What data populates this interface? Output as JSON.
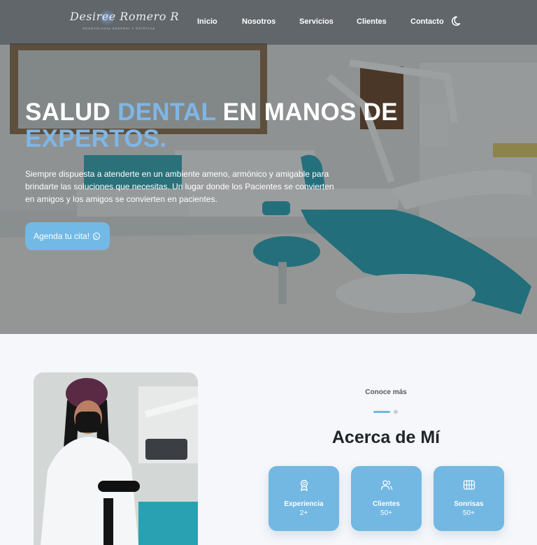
{
  "nav": {
    "logo_text": "Desiree Romero R",
    "logo_subtitle": "ODONTOLOGÍA GENERAL Y ESTÉTICA",
    "links": [
      "Inicio",
      "Nosotros",
      "Servicios",
      "Clientes",
      "Contacto"
    ],
    "theme_icon": "moon-icon"
  },
  "hero": {
    "title_part1": "SALUD ",
    "title_accent1": "DENTAL",
    "title_part2": " EN MANOS DE ",
    "title_accent2": "EXPERTOS.",
    "description": "Siempre dispuesta a atenderte en un ambiente ameno, armónico y amigable para brindarte las soluciones que necesitas. Un lugar donde los Pacientes se convierten en amigos y los amigos se convierten en pacientes.",
    "cta_label": "Agenda tu cita!",
    "cta_icon": "whatsapp-icon"
  },
  "about": {
    "eyebrow": "Conoce más",
    "title": "Acerca de Mí",
    "stats": [
      {
        "icon": "award-icon",
        "label": "Experiencia",
        "value": "2+"
      },
      {
        "icon": "users-icon",
        "label": "Clientes",
        "value": "50+"
      },
      {
        "icon": "grid-icon",
        "label": "Sonrisas",
        "value": "50+"
      }
    ]
  },
  "colors": {
    "accent": "#7fb6e6",
    "button": "#72b9e6",
    "card": "#73b8e3",
    "heading": "#1f2428"
  }
}
